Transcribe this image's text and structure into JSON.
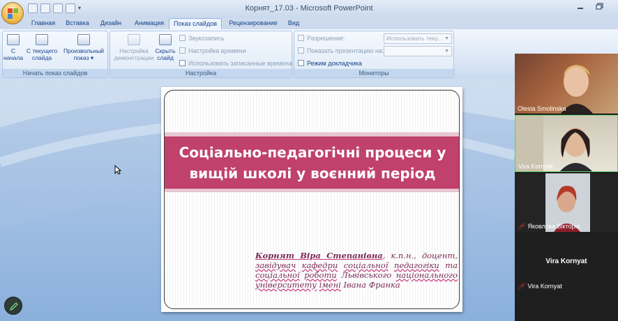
{
  "window": {
    "title": "Корнят_17.03 - Microsoft PowerPoint"
  },
  "tabs": [
    "Главная",
    "Вставка",
    "Дизайн",
    "Анимация",
    "Показ слайдов",
    "Рецензирование",
    "Вид"
  ],
  "active_tab": "Показ слайдов",
  "ribbon": {
    "group_start": {
      "label": "Начать показ слайдов",
      "from_start": [
        "С",
        "начала"
      ],
      "from_current": [
        "С текущего",
        "слайда"
      ],
      "custom": [
        "Произвольный",
        "показ ▾"
      ]
    },
    "group_setup": {
      "label": "Настройка",
      "setup_show": [
        "Настройка",
        "демонстрации"
      ],
      "hide_slide": [
        "Скрыть",
        "слайд"
      ],
      "record_narration": "Звукозапись",
      "rehearse_timings": "Настройка времени",
      "use_timings": "Использовать записанные времена"
    },
    "group_monitors": {
      "label": "Мониторы",
      "resolution_label": "Разрешение:",
      "resolution_value": "Использовать теку...",
      "show_on_label": "Показать презентацию на:",
      "show_on_value": "",
      "presenter_view": "Режим докладчика"
    }
  },
  "slide": {
    "title": "Соціально-педагогічні процеси у вищій школі у воєнний період",
    "author_name": "Корнят Віра Степанівна",
    "author_rest_words": [
      ", к.п.н., доцент, ",
      "завідувач",
      " ",
      "кафедри",
      " ",
      "соціальної",
      " ",
      "педагогіки",
      " та ",
      "соціальної",
      " ",
      "роботи",
      " Львівського ",
      "національного",
      " ",
      "університету",
      " ",
      "імені",
      " Івана Франка"
    ]
  },
  "participants": [
    {
      "name": "Olesia Smolinska",
      "muted": false
    },
    {
      "name": "Vira Kornyat",
      "muted": false
    },
    {
      "name": "Яковлєва Вікторія",
      "muted": true
    },
    {
      "name": "Vira Kornyat",
      "muted": true,
      "centered_label": "Vira Kornyat"
    }
  ],
  "colors": {
    "title_band": "#c0416b",
    "author_text": "#7a2b56",
    "ribbon_text": "#15428b"
  }
}
